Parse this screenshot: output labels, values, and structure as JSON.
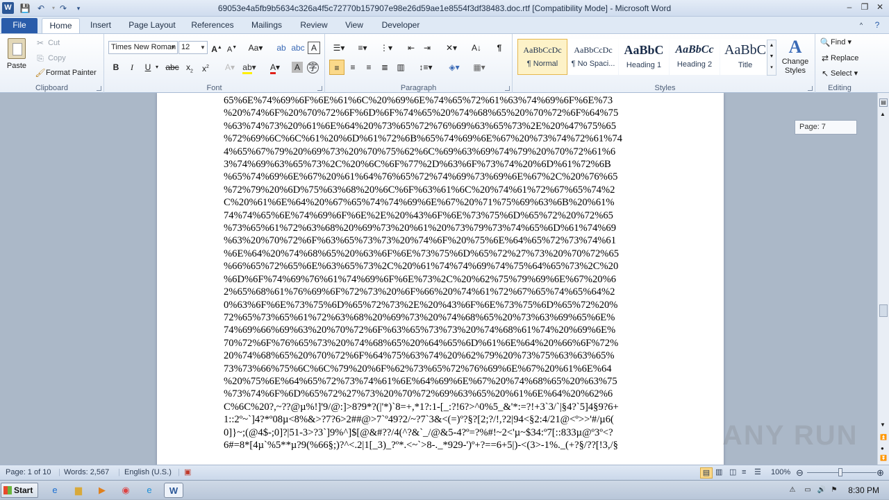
{
  "window": {
    "app_letter": "W",
    "title": "69053e4a5fb9b5634c326a4f5c72770b157907e98e26d59ae1e8554f3df38483.doc.rtf [Compatibility Mode] - Microsoft Word",
    "quick_access": {
      "save_icon": "save-icon",
      "undo_icon": "undo-icon",
      "redo_icon": "redo-icon",
      "customize_icon": "customize-icon"
    },
    "controls": {
      "minimize": "–",
      "restore": "❐",
      "close": "✕"
    }
  },
  "tabs": [
    "File",
    "Home",
    "Insert",
    "Page Layout",
    "References",
    "Mailings",
    "Review",
    "View",
    "Developer"
  ],
  "active_tab": "Home",
  "clipboard": {
    "paste": "Paste",
    "cut": "Cut",
    "copy": "Copy",
    "format_painter": "Format Painter",
    "label": "Clipboard"
  },
  "font": {
    "name": "Times New Roman",
    "size": "12",
    "label": "Font"
  },
  "paragraph": {
    "label": "Paragraph"
  },
  "styles": {
    "items": [
      {
        "sample": "AaBbCcDc",
        "name": "¶ Normal"
      },
      {
        "sample": "AaBbCcDc",
        "name": "¶ No Spaci..."
      },
      {
        "sample": "AaBbC",
        "name": "Heading 1"
      },
      {
        "sample": "AaBbCc",
        "name": "Heading 2"
      },
      {
        "sample": "AaBbC",
        "name": "Title"
      }
    ],
    "change_styles": "Change Styles",
    "label": "Styles"
  },
  "editing": {
    "find": "Find",
    "replace": "Replace",
    "select": "Select",
    "label": "Editing"
  },
  "document": {
    "page_tooltip": "Page: 7",
    "lines": [
      "65%6E%74%69%6F%6E%61%6C%20%69%6E%74%65%72%61%63%74%69%6F%6E%73",
      "%20%74%6F%20%70%72%6F%6D%6F%74%65%20%74%68%65%20%70%72%6F%64%75",
      "%63%74%73%20%61%6E%64%20%73%65%72%76%69%63%65%73%2E%20%47%75%65",
      "%72%69%6C%6C%61%20%6D%61%72%6B%65%74%69%6E%67%20%73%74%72%61%74",
      "4%65%67%79%20%69%73%20%70%75%62%6C%69%63%69%74%79%20%70%72%61%6",
      "3%74%69%63%65%73%2C%20%6C%6F%77%2D%63%6F%73%74%20%6D%61%72%6B",
      "%65%74%69%6E%67%20%61%64%76%65%72%74%69%73%69%6E%67%2C%20%76%65",
      "%72%79%20%6D%75%63%68%20%6C%6F%63%61%6C%20%74%61%72%67%65%74%2",
      "C%20%61%6E%64%20%67%65%74%74%69%6E%67%20%71%75%69%63%6B%20%61%",
      "74%74%65%6E%74%69%6F%6E%2E%20%43%6F%6E%73%75%6D%65%72%20%72%65",
      "%73%65%61%72%63%68%20%69%73%20%61%20%73%79%73%74%65%6D%61%74%69",
      "%63%20%70%72%6F%63%65%73%73%20%74%6F%20%75%6E%64%65%72%73%74%61",
      "%6E%64%20%74%68%65%20%63%6F%6E%73%75%6D%65%72%27%73%20%70%72%65",
      "%66%65%72%65%6E%63%65%73%2C%20%61%74%74%69%74%75%64%65%73%2C%20",
      "%6D%6F%74%69%76%61%74%69%6F%6E%73%2C%20%62%75%79%69%6E%67%20%6",
      "2%65%68%61%76%69%6F%72%73%20%6F%66%20%74%61%72%67%65%74%65%64%2",
      "0%63%6F%6E%73%75%6D%65%72%73%2E%20%43%6F%6E%73%75%6D%65%72%20%",
      "72%65%73%65%61%72%63%68%20%69%73%20%74%68%65%20%73%63%69%65%6E%",
      "74%69%66%69%63%20%70%72%6F%63%65%73%73%20%74%68%61%74%20%69%6E%",
      "70%72%6F%76%65%73%20%74%68%65%20%64%65%6D%61%6E%64%20%66%6F%72%",
      "20%74%68%65%20%70%72%6F%64%75%63%74%20%62%79%20%73%75%63%63%65%",
      "73%73%66%75%6C%6C%79%20%6F%62%73%65%72%76%69%6E%67%20%61%6E%64",
      "%20%75%6E%64%65%72%73%74%61%6E%64%69%6E%67%20%74%68%65%20%63%75",
      "%73%74%6F%6D%65%72%27%73%20%70%72%69%63%65%20%61%6E%64%20%62%6",
      "C%6C%20?,~??@µ%!]'9/@:]>8?9*?(|'*)`8=+,*1?:1-[_:?!6?>^0%5_&'*:=?!+3`3/`|§4?`5]4§9?6+",
      "1::2º~`]4?*º08µ<8%&>?7?6>2##@>7`º49?2/~?7`3&<(=)º?§?[2;?/!,?2|94<§2:4/21@<º>>'#/µ6(",
      "0]}~;(@4$-;0]?|51-3>?3`]9%^]$[@&#??/4(^?&`_/@&5-4?º=?%#!~2<'µ~$34:º7[::833µ@º3º<?",
      "6#=8*[4µ`%5**µ?9(%66§;)?^<.2|1[_3)_?º*.<~`>8-._*929-')º+?==6+5|)-<(3>-1%._(+?§/??[!3,/§"
    ]
  },
  "status": {
    "page": "Page: 1 of 10",
    "words": "Words: 2,567",
    "language": "English (U.S.)",
    "zoom": "100%"
  },
  "taskbar": {
    "start": "Start",
    "time": "8:30 PM"
  },
  "watermark": "ANY RUN"
}
